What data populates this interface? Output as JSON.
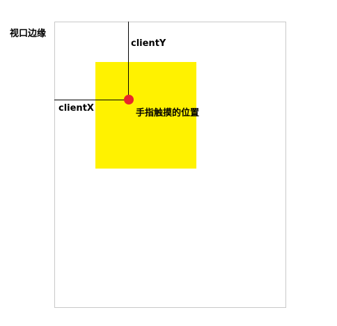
{
  "labels": {
    "viewport_edge": "视口边缘",
    "client_y": "clientY",
    "client_x": "clientX",
    "touch_position": "手指触摸的位置"
  },
  "colors": {
    "element_fill": "#fff200",
    "touch_dot": "#e8262b",
    "guide_line": "#000000",
    "viewport_border": "#c8c8c8"
  }
}
